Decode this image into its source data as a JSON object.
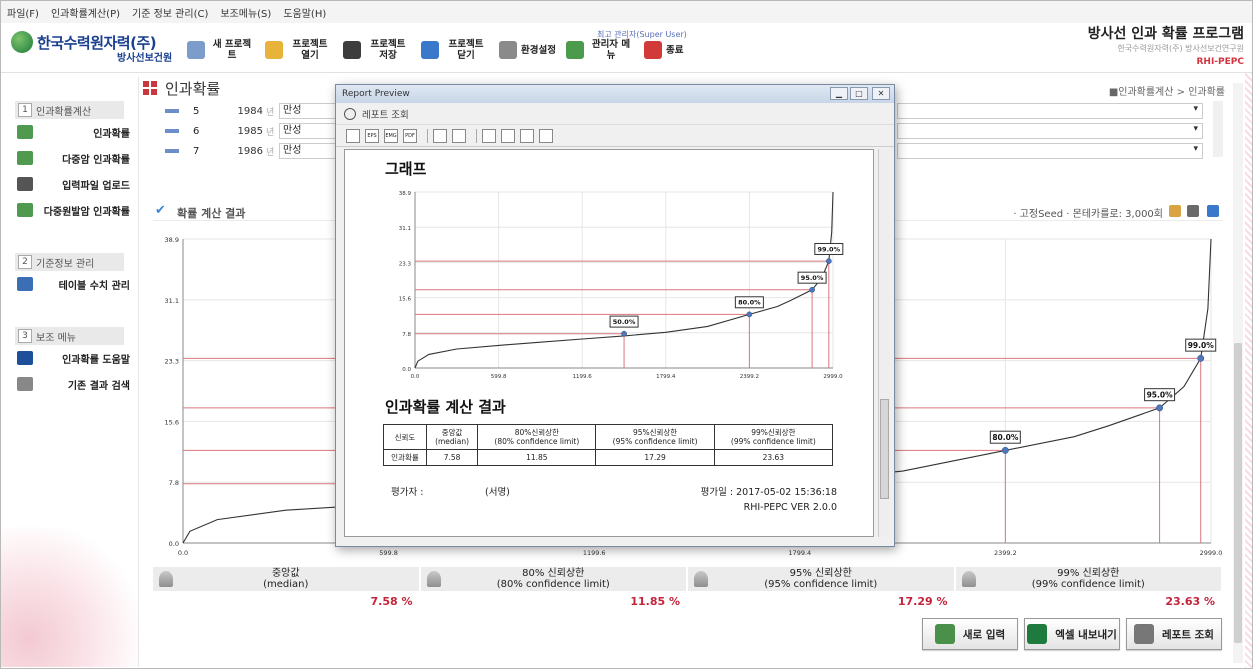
{
  "menubar": [
    "파일(F)",
    "인과확률계산(P)",
    "기준 정보 관리(C)",
    "보조메뉴(S)",
    "도움말(H)"
  ],
  "header": {
    "logo_text": "한국수력원자력(주)",
    "logo_sub": "방사선보건원",
    "super_user": "최고 관리자(Super User)",
    "program_title": "방사선 인과 확률 프로그램",
    "program_org": "한국수력원자력(주) 방사선보건연구원",
    "program_code": "RHI-PEPC",
    "toolbar": [
      {
        "label": "새 프로젝트",
        "icon": "new-project-icon",
        "color": "#7c9ccc"
      },
      {
        "label": "프로젝트 열기",
        "icon": "folder-open-icon",
        "color": "#e8b33a"
      },
      {
        "label": "프로젝트 저장",
        "icon": "save-icon",
        "color": "#3d3d3d"
      },
      {
        "label": "프로젝트 닫기",
        "icon": "close-project-icon",
        "color": "#3a79c9"
      },
      {
        "label": "환경설정",
        "icon": "tools-icon",
        "color": "#8a8a8a"
      },
      {
        "label": "관리자 메뉴",
        "icon": "admin-icon",
        "color": "#4c9a4c"
      },
      {
        "label": "종료",
        "icon": "exit-icon",
        "color": "#d23a3a"
      }
    ]
  },
  "sidebar": {
    "sections": [
      {
        "num": "1",
        "title": "인과확률계산",
        "items": [
          {
            "label": "인과확률",
            "icon": "bar-person-icon",
            "color": "#4f9a4f"
          },
          {
            "label": "다중암 인과확률",
            "icon": "multi-bar-icon",
            "color": "#4f9a4f"
          },
          {
            "label": "입력파일 업로드",
            "icon": "folder-upload-icon",
            "color": "#555555"
          },
          {
            "label": "다중원발암 인과확률",
            "icon": "grid-icon",
            "color": "#4f9a4f"
          }
        ]
      },
      {
        "num": "2",
        "title": "기준정보 관리",
        "items": [
          {
            "label": "테이블 수치 관리",
            "icon": "table-edit-icon",
            "color": "#3a6fb4"
          }
        ]
      },
      {
        "num": "3",
        "title": "보조 메뉴",
        "items": [
          {
            "label": "인과확률 도움말",
            "icon": "help-icon",
            "color": "#1e4f9a"
          },
          {
            "label": "기존 결과 검색",
            "icon": "search-icon",
            "color": "#888888"
          }
        ]
      }
    ]
  },
  "page": {
    "title": "인과확률",
    "breadcrumb": "■인과확률계산 > 인과확률"
  },
  "rows": [
    {
      "no": "5",
      "year": "1984",
      "unit": "년",
      "type": "만성"
    },
    {
      "no": "6",
      "year": "1985",
      "unit": "년",
      "type": "만성"
    },
    {
      "no": "7",
      "year": "1986",
      "unit": "년",
      "type": "만성"
    }
  ],
  "result": {
    "title": "확률 계산 결과",
    "meta": "· 고정Seed  · 몬테카를로: 3,000회"
  },
  "chart_data": [
    {
      "type": "line",
      "x_ticks": [
        "0.0",
        "599.8",
        "1199.6",
        "1799.4",
        "2399.2",
        "2999.0"
      ],
      "y_ticks": [
        "0.0",
        "7.8",
        "15.6",
        "23.3",
        "31.1",
        "38.9"
      ],
      "xlim": [
        0,
        2999
      ],
      "ylim": [
        0,
        38.9
      ],
      "curve": [
        [
          0,
          0
        ],
        [
          20,
          1.5
        ],
        [
          100,
          3.0
        ],
        [
          300,
          4.2
        ],
        [
          600,
          5.0
        ],
        [
          900,
          5.7
        ],
        [
          1200,
          6.4
        ],
        [
          1500,
          7.1
        ],
        [
          1800,
          7.9
        ],
        [
          2100,
          9.2
        ],
        [
          2399,
          11.85
        ],
        [
          2600,
          13.6
        ],
        [
          2700,
          15.0
        ],
        [
          2849,
          17.29
        ],
        [
          2920,
          20.0
        ],
        [
          2969,
          23.63
        ],
        [
          2990,
          30.0
        ],
        [
          2999,
          38.9
        ]
      ],
      "markers": [
        {
          "label": "50.0%",
          "x": 1500,
          "y": 7.58
        },
        {
          "label": "80.0%",
          "x": 2399,
          "y": 11.85
        },
        {
          "label": "95.0%",
          "x": 2849,
          "y": 17.29
        },
        {
          "label": "99.0%",
          "x": 2969,
          "y": 23.63
        }
      ]
    }
  ],
  "stats": [
    {
      "label1": "중앙값",
      "label2": "(median)",
      "value": "7.58 %"
    },
    {
      "label1": "80% 신뢰상한",
      "label2": "(80% confidence limit)",
      "value": "11.85 %"
    },
    {
      "label1": "95% 신뢰상한",
      "label2": "(95% confidence limit)",
      "value": "17.29 %"
    },
    {
      "label1": "99% 신뢰상한",
      "label2": "(99% confidence limit)",
      "value": "23.63 %"
    }
  ],
  "buttons": [
    {
      "label": "새로 입력",
      "icon": "refresh-icon",
      "color": "#4a8f4a"
    },
    {
      "label": "엑셀 내보내기",
      "icon": "excel-icon",
      "color": "#1f7a3e"
    },
    {
      "label": "레포트 조회",
      "icon": "report-search-icon",
      "color": "#777777"
    }
  ],
  "report": {
    "window_title": "Report Preview",
    "toolbar_label": "레포트 조회",
    "tools": [
      "print",
      "EPS",
      "EMG",
      "PDF",
      "zoom-in",
      "zoom-out",
      "fit",
      "page-width",
      "single-page",
      "two-page"
    ],
    "graph_heading": "그래프",
    "result_heading": "인과확률 계산 결과",
    "table": {
      "headers": [
        [
          "신뢰도",
          ""
        ],
        [
          "중앙값",
          "(median)"
        ],
        [
          "80%신뢰상한",
          "(80% confidence limit)"
        ],
        [
          "95%신뢰상한",
          "(95% confidence limit)"
        ],
        [
          "99%신뢰상한",
          "(99% confidence limit)"
        ]
      ],
      "row": [
        "인과확률",
        "7.58",
        "11.85",
        "17.29",
        "23.63"
      ]
    },
    "evaluator_label": "평가자 :",
    "signature": "(서명)",
    "eval_date": "평가일 : 2017-05-02 15:36:18",
    "version": "RHI-PEPC VER 2.0.0"
  }
}
